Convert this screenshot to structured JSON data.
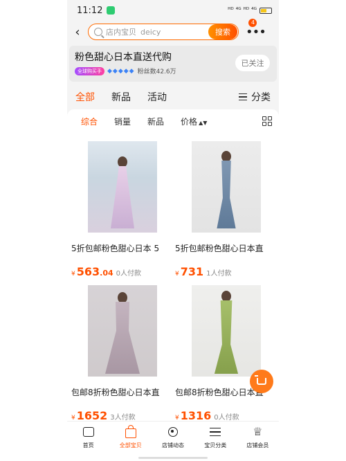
{
  "status_bar": {
    "time": "11:12",
    "signal": "ᴴᴰ ⁴ᴳ ᴴᴰ ⁴ᴳ"
  },
  "search": {
    "placeholder_label": "店内宝贝",
    "query": "deicy",
    "button": "搜索",
    "badge": "4"
  },
  "shop": {
    "name": "粉色甜心日本直送代购",
    "tag": "全球购买手",
    "fans": "粉丝数42.6万",
    "follow": "已关注"
  },
  "category_tabs": {
    "items": [
      "全部",
      "新品",
      "活动"
    ],
    "classify": "分类"
  },
  "sort_bar": {
    "items": [
      "综合",
      "销量",
      "新品",
      "价格"
    ],
    "price_arrows": "▲▼"
  },
  "products": [
    {
      "title": "5折包邮粉色甜心日本 5",
      "currency": "¥",
      "price_int": "563",
      "price_dec": ".04",
      "sold": "0人付款"
    },
    {
      "title": "5折包邮粉色甜心日本直",
      "currency": "¥",
      "price_int": "731",
      "price_dec": "",
      "sold": "1人付款"
    },
    {
      "title": "包邮8折粉色甜心日本直",
      "currency": "¥",
      "price_int": "1652",
      "price_dec": "",
      "sold": "3人付款"
    },
    {
      "title": "包邮8折粉色甜心日本直",
      "currency": "¥",
      "price_int": "1316",
      "price_dec": "",
      "sold": "0人付款"
    }
  ],
  "bottom_nav": [
    {
      "label": "首页",
      "icon": "home-icon"
    },
    {
      "label": "全部宝贝",
      "icon": "bag-icon"
    },
    {
      "label": "店铺动态",
      "icon": "live-icon"
    },
    {
      "label": "宝贝分类",
      "icon": "category-icon"
    },
    {
      "label": "店铺会员",
      "icon": "crown-icon"
    }
  ],
  "colors": {
    "accent": "#ff5000",
    "background": "#f4f4f4"
  }
}
